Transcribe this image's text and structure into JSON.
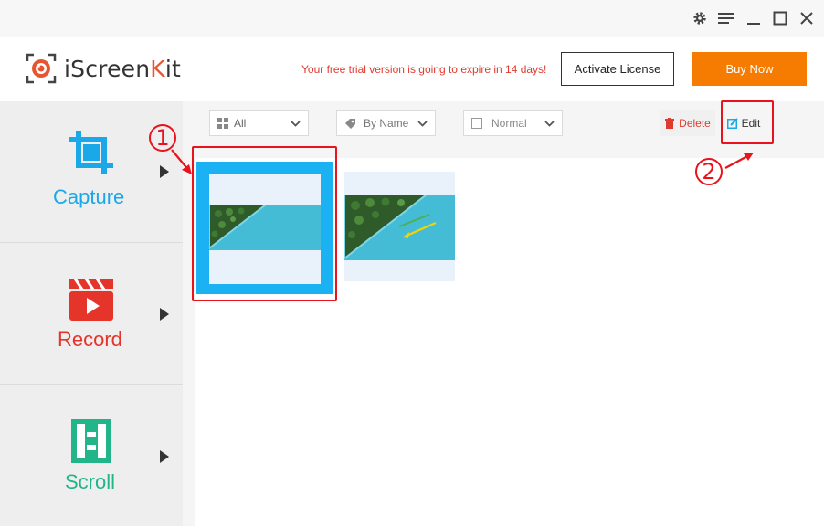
{
  "window_controls": [
    "gear-icon",
    "menu-icon",
    "minimize-icon",
    "maximize-icon",
    "close-icon"
  ],
  "header": {
    "logo_prefix": "iScreen",
    "logo_accent": "K",
    "logo_suffix": "it",
    "trial_message": "Your free trial version is going to expire in 14 days!",
    "activate_label": "Activate License",
    "buy_label": "Buy Now"
  },
  "sidebar": {
    "items": [
      {
        "label": "Capture",
        "icon": "crop-icon",
        "color": "#1aa8e8"
      },
      {
        "label": "Record",
        "icon": "video-record-icon",
        "color": "#e5352b"
      },
      {
        "label": "Scroll",
        "icon": "scroll-capture-icon",
        "color": "#22b58a"
      }
    ]
  },
  "toolbar": {
    "filter_value": "All",
    "sort_value": "By Name",
    "view_value": "Normal",
    "delete_label": "Delete",
    "edit_label": "Edit"
  },
  "annotations": {
    "step1": "1",
    "step2": "2"
  },
  "colors": {
    "accent_orange": "#f57c00",
    "alert_red": "#e03a2e",
    "selection_blue": "#1ab2f2",
    "annotation_red": "#e8131c"
  }
}
